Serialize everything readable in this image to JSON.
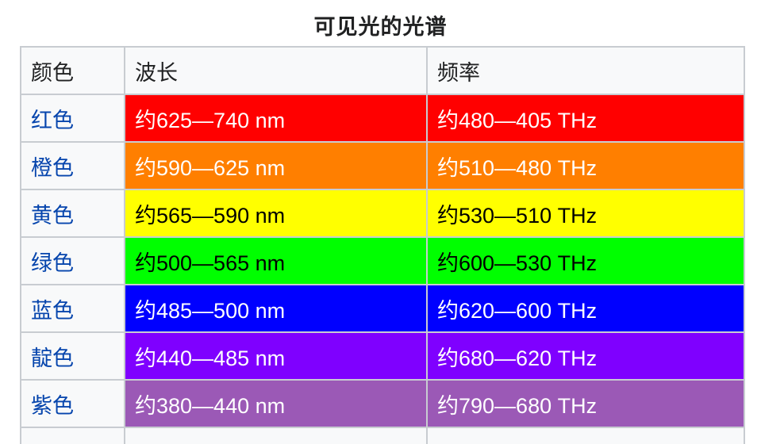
{
  "table": {
    "caption": "可见光的光谱",
    "headers": {
      "color": "颜色",
      "wavelength": "波长",
      "frequency": "频率"
    },
    "rows": [
      {
        "name": "红色",
        "wavelength": "约625—740 nm",
        "frequency": "约480—405 THz",
        "bg": "#ff0000",
        "fg": "#ffffff"
      },
      {
        "name": "橙色",
        "wavelength": "约590—625 nm",
        "frequency": "约510—480 THz",
        "bg": "#ff7f00",
        "fg": "#ffffff"
      },
      {
        "name": "黄色",
        "wavelength": "约565—590 nm",
        "frequency": "约530—510 THz",
        "bg": "#ffff00",
        "fg": "#000000"
      },
      {
        "name": "绿色",
        "wavelength": "约500—565 nm",
        "frequency": "约600—530 THz",
        "bg": "#00ff00",
        "fg": "#000000"
      },
      {
        "name": "蓝色",
        "wavelength": "约485—500 nm",
        "frequency": "约620—600 THz",
        "bg": "#0000ff",
        "fg": "#ffffff"
      },
      {
        "name": "靛色",
        "wavelength": "约440—485 nm",
        "frequency": "约680—620 THz",
        "bg": "#7f00ff",
        "fg": "#ffffff"
      },
      {
        "name": "紫色",
        "wavelength": "约380—440 nm",
        "frequency": "约790—680 THz",
        "bg": "#9b59b6",
        "fg": "#ffffff"
      }
    ]
  }
}
